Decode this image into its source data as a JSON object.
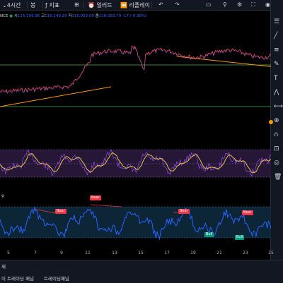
{
  "topbar": {
    "interval_label": "4시간",
    "chart_type": "봉",
    "indicators_label": "지표",
    "alert_label": "얼러트",
    "replay_label": "리플레이"
  },
  "symbol": {
    "exchange_suffix": "NCE",
    "ohlc": {
      "open_label": "시",
      "open": "116,109.96",
      "high_label": "고",
      "high": "116,149.29",
      "low_label": "저",
      "low": "115,933.00",
      "close_label": "종",
      "close": "116,083.79",
      "change": "-17 (-0.38%)"
    }
  },
  "x_axis": {
    "ticks": [
      "5",
      "7",
      "9",
      "11",
      "13",
      "15",
      "17",
      "19",
      "21",
      "23",
      "25"
    ]
  },
  "bottom": {
    "row1_left": "제",
    "row2_label1": "이 트레이딩 패널",
    "row2_label2": "트레이딩패널"
  },
  "signals": [
    {
      "label": "Bear",
      "kind": "bear"
    },
    {
      "label": "Bear",
      "kind": "bear"
    },
    {
      "label": "Bear",
      "kind": "bear"
    },
    {
      "label": "Bear",
      "kind": "bear"
    },
    {
      "label": "Bull",
      "kind": "bull"
    },
    {
      "label": "Bull",
      "kind": "bull"
    }
  ],
  "indicator": {
    "name": "φ"
  },
  "colors": {
    "price_line": "#f7525f",
    "trend": "#ff9800",
    "hline": "#4caf50",
    "osc_line": "#e6c34a",
    "osc_band": "#7e57c2",
    "rsi_line": "#2962ff",
    "rsi_band": "#2a4d6e"
  }
}
